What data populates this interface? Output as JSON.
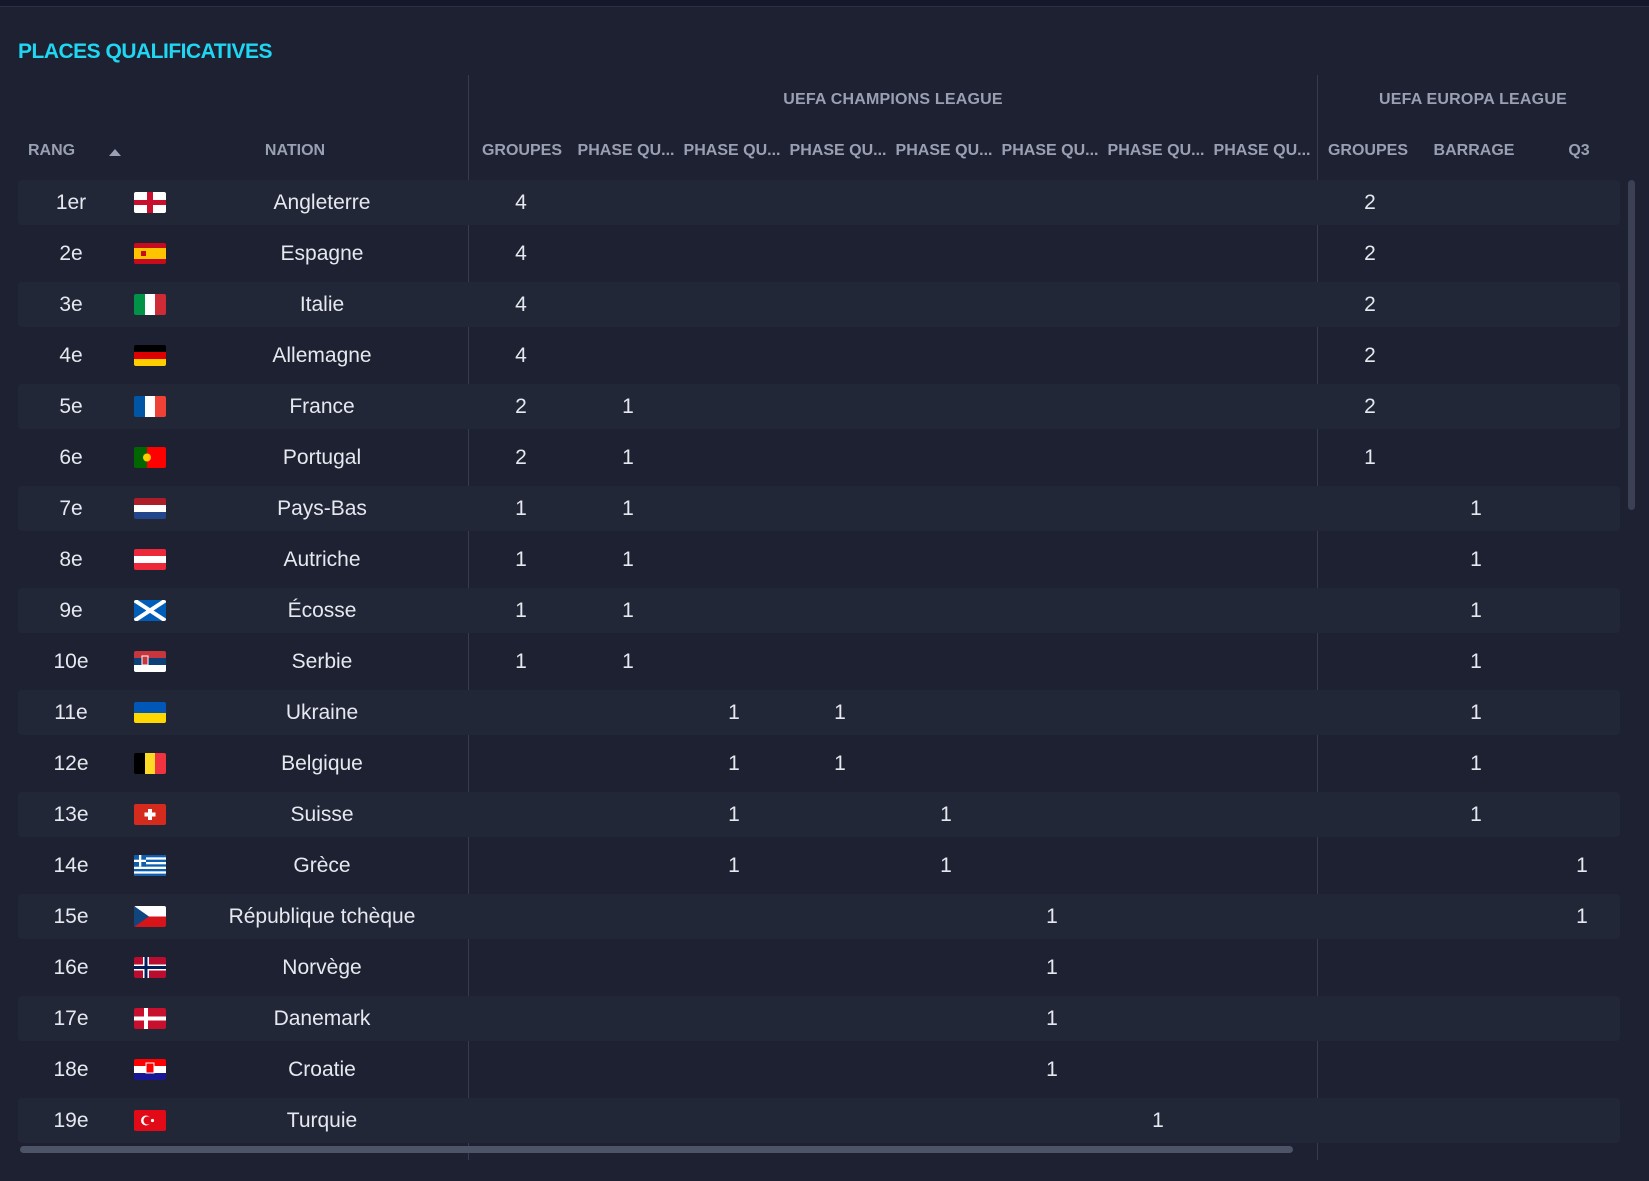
{
  "title": "PLACES QUALIFICATIVES",
  "groups": {
    "ucl": "UEFA CHAMPIONS LEAGUE",
    "uel": "UEFA EUROPA LEAGUE"
  },
  "columns": {
    "rank": "RANG",
    "nation": "NATION",
    "ucl_groups": "GROUPES",
    "ucl_q1": "PHASE QU...",
    "ucl_q2": "PHASE QU...",
    "ucl_q3": "PHASE QU...",
    "ucl_q4": "PHASE QU...",
    "ucl_q5": "PHASE QU...",
    "ucl_q6": "PHASE QU...",
    "ucl_q7": "PHASE QU...",
    "uel_groups": "GROUPES",
    "uel_barrage": "BARRAGE",
    "uel_q3": "Q3"
  },
  "flag_colors": {
    "england": [
      "#ffffff",
      "#c8102e"
    ],
    "spain": [
      "#c60b1e",
      "#ffc400"
    ],
    "italy": [
      "#009246",
      "#ffffff",
      "#ce2b37"
    ],
    "germany": [
      "#000000",
      "#dd0000",
      "#ffce00"
    ],
    "france": [
      "#0055a4",
      "#ffffff",
      "#ef4135"
    ],
    "portugal": [
      "#006600",
      "#ff0000"
    ],
    "netherlands": [
      "#ae1c28",
      "#ffffff",
      "#21468b"
    ],
    "austria": [
      "#ed2939",
      "#ffffff",
      "#ed2939"
    ],
    "scotland": [
      "#005eb8",
      "#ffffff"
    ],
    "serbia": [
      "#c6363c",
      "#0c4076",
      "#ffffff"
    ],
    "ukraine": [
      "#0057b7",
      "#ffd700"
    ],
    "belgium": [
      "#000000",
      "#fdda24",
      "#ef3340"
    ],
    "switzerland": [
      "#d52b1e",
      "#ffffff"
    ],
    "greece": [
      "#0d5eaf",
      "#ffffff"
    ],
    "czechia": [
      "#ffffff",
      "#d7141a",
      "#11457e"
    ],
    "norway": [
      "#ba0c2f",
      "#ffffff",
      "#00205b"
    ],
    "denmark": [
      "#c8102e",
      "#ffffff"
    ],
    "croatia": [
      "#ff0000",
      "#ffffff",
      "#171796"
    ],
    "turkey": [
      "#e30a17",
      "#ffffff"
    ]
  },
  "rows": [
    {
      "rank": "1er",
      "flag": "england",
      "nation": "Angleterre",
      "ucl_groups": "4",
      "ucl_q1": "",
      "ucl_q2": "",
      "ucl_q3": "",
      "ucl_q4": "",
      "ucl_q5": "",
      "ucl_q6": "",
      "ucl_q7": "",
      "uel_groups": "2",
      "uel_barrage": "",
      "uel_q3": ""
    },
    {
      "rank": "2e",
      "flag": "spain",
      "nation": "Espagne",
      "ucl_groups": "4",
      "ucl_q1": "",
      "ucl_q2": "",
      "ucl_q3": "",
      "ucl_q4": "",
      "ucl_q5": "",
      "ucl_q6": "",
      "ucl_q7": "",
      "uel_groups": "2",
      "uel_barrage": "",
      "uel_q3": ""
    },
    {
      "rank": "3e",
      "flag": "italy",
      "nation": "Italie",
      "ucl_groups": "4",
      "ucl_q1": "",
      "ucl_q2": "",
      "ucl_q3": "",
      "ucl_q4": "",
      "ucl_q5": "",
      "ucl_q6": "",
      "ucl_q7": "",
      "uel_groups": "2",
      "uel_barrage": "",
      "uel_q3": ""
    },
    {
      "rank": "4e",
      "flag": "germany",
      "nation": "Allemagne",
      "ucl_groups": "4",
      "ucl_q1": "",
      "ucl_q2": "",
      "ucl_q3": "",
      "ucl_q4": "",
      "ucl_q5": "",
      "ucl_q6": "",
      "ucl_q7": "",
      "uel_groups": "2",
      "uel_barrage": "",
      "uel_q3": ""
    },
    {
      "rank": "5e",
      "flag": "france",
      "nation": "France",
      "ucl_groups": "2",
      "ucl_q1": "1",
      "ucl_q2": "",
      "ucl_q3": "",
      "ucl_q4": "",
      "ucl_q5": "",
      "ucl_q6": "",
      "ucl_q7": "",
      "uel_groups": "2",
      "uel_barrage": "",
      "uel_q3": ""
    },
    {
      "rank": "6e",
      "flag": "portugal",
      "nation": "Portugal",
      "ucl_groups": "2",
      "ucl_q1": "1",
      "ucl_q2": "",
      "ucl_q3": "",
      "ucl_q4": "",
      "ucl_q5": "",
      "ucl_q6": "",
      "ucl_q7": "",
      "uel_groups": "1",
      "uel_barrage": "",
      "uel_q3": ""
    },
    {
      "rank": "7e",
      "flag": "netherlands",
      "nation": "Pays-Bas",
      "ucl_groups": "1",
      "ucl_q1": "1",
      "ucl_q2": "",
      "ucl_q3": "",
      "ucl_q4": "",
      "ucl_q5": "",
      "ucl_q6": "",
      "ucl_q7": "",
      "uel_groups": "",
      "uel_barrage": "1",
      "uel_q3": ""
    },
    {
      "rank": "8e",
      "flag": "austria",
      "nation": "Autriche",
      "ucl_groups": "1",
      "ucl_q1": "1",
      "ucl_q2": "",
      "ucl_q3": "",
      "ucl_q4": "",
      "ucl_q5": "",
      "ucl_q6": "",
      "ucl_q7": "",
      "uel_groups": "",
      "uel_barrage": "1",
      "uel_q3": ""
    },
    {
      "rank": "9e",
      "flag": "scotland",
      "nation": "Écosse",
      "ucl_groups": "1",
      "ucl_q1": "1",
      "ucl_q2": "",
      "ucl_q3": "",
      "ucl_q4": "",
      "ucl_q5": "",
      "ucl_q6": "",
      "ucl_q7": "",
      "uel_groups": "",
      "uel_barrage": "1",
      "uel_q3": ""
    },
    {
      "rank": "10e",
      "flag": "serbia",
      "nation": "Serbie",
      "ucl_groups": "1",
      "ucl_q1": "1",
      "ucl_q2": "",
      "ucl_q3": "",
      "ucl_q4": "",
      "ucl_q5": "",
      "ucl_q6": "",
      "ucl_q7": "",
      "uel_groups": "",
      "uel_barrage": "1",
      "uel_q3": ""
    },
    {
      "rank": "11e",
      "flag": "ukraine",
      "nation": "Ukraine",
      "ucl_groups": "",
      "ucl_q1": "",
      "ucl_q2": "1",
      "ucl_q3": "1",
      "ucl_q4": "",
      "ucl_q5": "",
      "ucl_q6": "",
      "ucl_q7": "",
      "uel_groups": "",
      "uel_barrage": "1",
      "uel_q3": ""
    },
    {
      "rank": "12e",
      "flag": "belgium",
      "nation": "Belgique",
      "ucl_groups": "",
      "ucl_q1": "",
      "ucl_q2": "1",
      "ucl_q3": "1",
      "ucl_q4": "",
      "ucl_q5": "",
      "ucl_q6": "",
      "ucl_q7": "",
      "uel_groups": "",
      "uel_barrage": "1",
      "uel_q3": ""
    },
    {
      "rank": "13e",
      "flag": "switzerland",
      "nation": "Suisse",
      "ucl_groups": "",
      "ucl_q1": "",
      "ucl_q2": "1",
      "ucl_q3": "",
      "ucl_q4": "1",
      "ucl_q5": "",
      "ucl_q6": "",
      "ucl_q7": "",
      "uel_groups": "",
      "uel_barrage": "1",
      "uel_q3": ""
    },
    {
      "rank": "14e",
      "flag": "greece",
      "nation": "Grèce",
      "ucl_groups": "",
      "ucl_q1": "",
      "ucl_q2": "1",
      "ucl_q3": "",
      "ucl_q4": "1",
      "ucl_q5": "",
      "ucl_q6": "",
      "ucl_q7": "",
      "uel_groups": "",
      "uel_barrage": "",
      "uel_q3": "1"
    },
    {
      "rank": "15e",
      "flag": "czechia",
      "nation": "République tchèque",
      "ucl_groups": "",
      "ucl_q1": "",
      "ucl_q2": "",
      "ucl_q3": "",
      "ucl_q4": "",
      "ucl_q5": "1",
      "ucl_q6": "",
      "ucl_q7": "",
      "uel_groups": "",
      "uel_barrage": "",
      "uel_q3": "1"
    },
    {
      "rank": "16e",
      "flag": "norway",
      "nation": "Norvège",
      "ucl_groups": "",
      "ucl_q1": "",
      "ucl_q2": "",
      "ucl_q3": "",
      "ucl_q4": "",
      "ucl_q5": "1",
      "ucl_q6": "",
      "ucl_q7": "",
      "uel_groups": "",
      "uel_barrage": "",
      "uel_q3": ""
    },
    {
      "rank": "17e",
      "flag": "denmark",
      "nation": "Danemark",
      "ucl_groups": "",
      "ucl_q1": "",
      "ucl_q2": "",
      "ucl_q3": "",
      "ucl_q4": "",
      "ucl_q5": "1",
      "ucl_q6": "",
      "ucl_q7": "",
      "uel_groups": "",
      "uel_barrage": "",
      "uel_q3": ""
    },
    {
      "rank": "18e",
      "flag": "croatia",
      "nation": "Croatie",
      "ucl_groups": "",
      "ucl_q1": "",
      "ucl_q2": "",
      "ucl_q3": "",
      "ucl_q4": "",
      "ucl_q5": "1",
      "ucl_q6": "",
      "ucl_q7": "",
      "uel_groups": "",
      "uel_barrage": "",
      "uel_q3": ""
    },
    {
      "rank": "19e",
      "flag": "turkey",
      "nation": "Turquie",
      "ucl_groups": "",
      "ucl_q1": "",
      "ucl_q2": "",
      "ucl_q3": "",
      "ucl_q4": "",
      "ucl_q5": "",
      "ucl_q6": "1",
      "ucl_q7": "",
      "uel_groups": "",
      "uel_barrage": "",
      "uel_q3": ""
    }
  ]
}
